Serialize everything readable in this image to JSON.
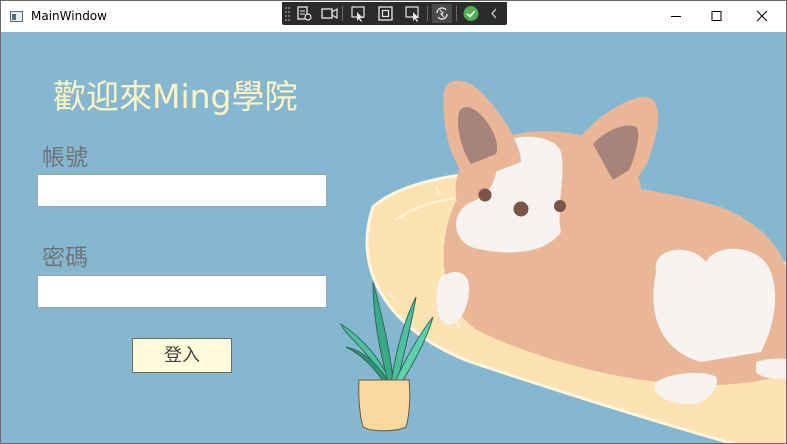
{
  "window": {
    "title": "MainWindow",
    "icons": [
      "app-icon",
      "minimize-icon",
      "maximize-icon",
      "close-icon"
    ]
  },
  "debug_toolbar": {
    "icons": [
      "grip-icon",
      "live-visual-tree-icon",
      "video-icon",
      "select-element-icon",
      "layout-adorner-icon",
      "track-focus-icon",
      "hot-reload-icon",
      "check-icon",
      "collapse-chevron-icon"
    ]
  },
  "login": {
    "welcome": "歡迎來Ming學院",
    "account_label": "帳號",
    "account_value": "",
    "password_label": "密碼",
    "password_value": "",
    "login_button": "登入"
  },
  "illustration": {
    "subjects": [
      "corgi",
      "cushion",
      "potted-plant"
    ]
  },
  "colors": {
    "background": "#85b8d0",
    "welcome_text": "#fff3c4",
    "button_fill": "#fffbdc",
    "cushion": "#fde3b3",
    "corgi_fur": "#e9b798"
  }
}
